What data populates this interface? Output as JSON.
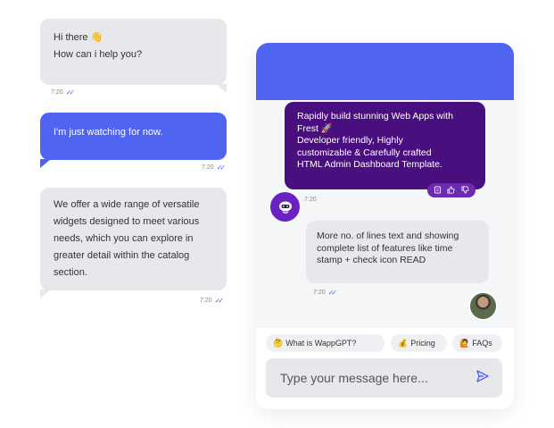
{
  "left_chat": {
    "msg1": {
      "line1": "Hi there 👋",
      "line2": "How can i help you?",
      "time": "7:20"
    },
    "msg2": {
      "text": "I'm just watching for now.",
      "time": "7:20"
    },
    "msg3": {
      "text": "We offer a wide range of versatile widgets designed to meet various needs, which you can explore in greater detail within the catalog section.",
      "time": "7:20"
    }
  },
  "widget": {
    "bot_message": {
      "line1": "Rapidly build stunning Web Apps with",
      "line2": "Frest 🚀",
      "line3": "Developer friendly, Highly",
      "line4": "customizable & Carefully crafted",
      "line5": "HTML Admin Dashboard Template.",
      "time": "7:20"
    },
    "user_message": {
      "text": "More no. of lines text and showing complete list of features like time stamp + check icon READ",
      "time": "7:20"
    },
    "chips": [
      {
        "emoji": "🤔",
        "label": "What is WappGPT?"
      },
      {
        "emoji": "💰",
        "label": "Pricing"
      },
      {
        "emoji": "🙋",
        "label": "FAQs"
      }
    ],
    "input_placeholder": "Type your message here...",
    "colors": {
      "header": "#4f64f0",
      "bot_bubble": "#4a0f7e",
      "accent": "#4f64f0"
    },
    "icons": [
      "copy-icon",
      "thumbs-up-icon",
      "thumbs-down-icon",
      "robot-icon",
      "send-icon",
      "double-check-icon"
    ]
  }
}
